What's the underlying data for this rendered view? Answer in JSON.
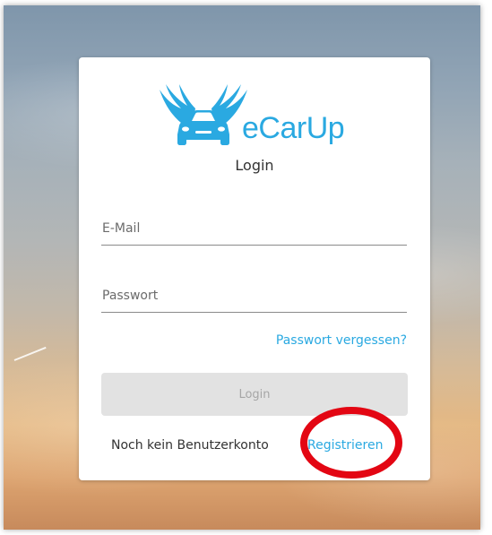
{
  "app": {
    "logo_text": "eCarUp",
    "logo_icon": "winged-car-icon"
  },
  "login_form": {
    "title": "Login",
    "email_placeholder": "E-Mail",
    "email_value": "",
    "password_placeholder": "Passwort",
    "password_value": "",
    "forgot_password_label": "Passwort vergessen?",
    "login_button_label": "Login",
    "login_button_state": "disabled",
    "no_account_text": "Noch kein Benutzerkonto",
    "register_label": "Registrieren"
  },
  "annotation": {
    "type": "highlight-circle",
    "target": "register-link",
    "color": "#e30613"
  },
  "colors": {
    "accent": "#2aa9e1",
    "button_disabled_bg": "#e2e2e2",
    "button_disabled_text": "#a6a6a6"
  }
}
